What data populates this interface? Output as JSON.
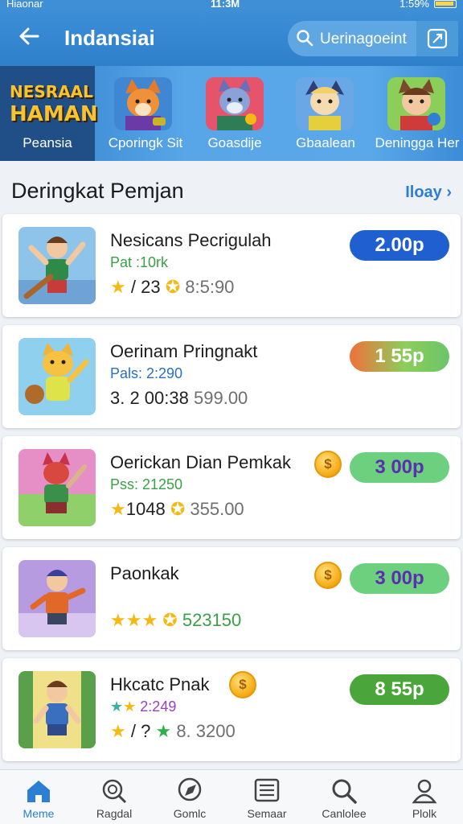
{
  "status": {
    "carrier": "Hiaonar",
    "time": "11:3M",
    "battery": "1:59%"
  },
  "header": {
    "title": "Indansiai",
    "search_text": "Uerinagoeint"
  },
  "brand": {
    "logo_line1": "NESRAAL",
    "logo_line2": "HAMAN",
    "label": "Peansia"
  },
  "categories": [
    {
      "label": "Cporingk Sit"
    },
    {
      "label": "Goasdije"
    },
    {
      "label": "Gbaalean"
    },
    {
      "label": "Deningga Her"
    }
  ],
  "section": {
    "title": "Deringkat Pemjan",
    "see_all": "Iloay"
  },
  "items": [
    {
      "name": "Nesicans Pecrigulah",
      "sub": "Pat :10rk",
      "count": "/ 23",
      "extra": "8:5:90",
      "price": "2.00p"
    },
    {
      "name": "Oerinam Pringnakt",
      "sub": "Pals: 2:290",
      "count": "3. 2 00:38",
      "extra": "599.00",
      "price": "1 55p"
    },
    {
      "name": "Oerickan Dian Pemkak",
      "sub": "Pss: 21250",
      "count": "1048",
      "extra": "355.00",
      "price": "3 00p"
    },
    {
      "name": "Paonkak",
      "sub": "",
      "count": "",
      "extra": "523150",
      "price": "3 00p"
    },
    {
      "name": "Hkcatc Pnak",
      "sub": "2:249",
      "count": "/ ?",
      "extra": "8. 3200",
      "price": "8 55p"
    }
  ],
  "nav": [
    {
      "label": "Meme"
    },
    {
      "label": "Ragdal"
    },
    {
      "label": "Gomlc"
    },
    {
      "label": "Semaar"
    },
    {
      "label": "Canlolee"
    },
    {
      "label": "Plolk"
    }
  ],
  "colors": {
    "primary": "#2f80cb",
    "price_blue": "#1f5fcf",
    "price_green": "#58c06a",
    "accent_star": "#f5b915"
  }
}
